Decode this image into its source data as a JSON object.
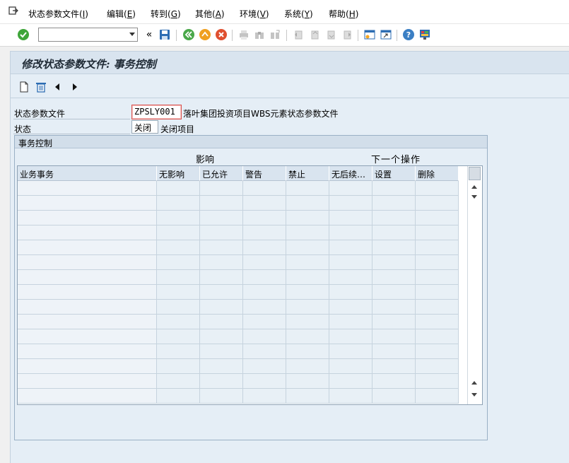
{
  "menu": {
    "items": [
      {
        "label": "状态参数文件(",
        "key": "I",
        "end": ")"
      },
      {
        "label": "编辑(",
        "key": "E",
        "end": ")"
      },
      {
        "label": "转到(",
        "key": "G",
        "end": ")"
      },
      {
        "label": "其他(",
        "key": "A",
        "end": ")"
      },
      {
        "label": "环境(",
        "key": "V",
        "end": ")"
      },
      {
        "label": "系统(",
        "key": "Y",
        "end": ")"
      },
      {
        "label": "帮助(",
        "key": "H",
        "end": ")"
      }
    ]
  },
  "toolbar": {
    "command_value": "",
    "back_glyph": "«"
  },
  "screen": {
    "title": "修改状态参数文件: 事务控制"
  },
  "form": {
    "profile_label": "状态参数文件",
    "profile_value": "ZPSLY001",
    "profile_desc": "落叶集团投资项目WBS元素状态参数文件",
    "status_label": "状态",
    "status_value": "关闭",
    "status_desc": "关闭项目"
  },
  "group": {
    "title": "事务控制",
    "influence_header": "影响",
    "next_action_header": "下一个操作",
    "columns": [
      "业务事务",
      "无影响",
      "已允许",
      "警告",
      "禁止",
      "无后续…",
      "设置",
      "删除"
    ]
  },
  "colors": {
    "panel_bg": "#e5eef6",
    "title_bar": "#d9e4ef",
    "accent_red": "#d9534f"
  }
}
